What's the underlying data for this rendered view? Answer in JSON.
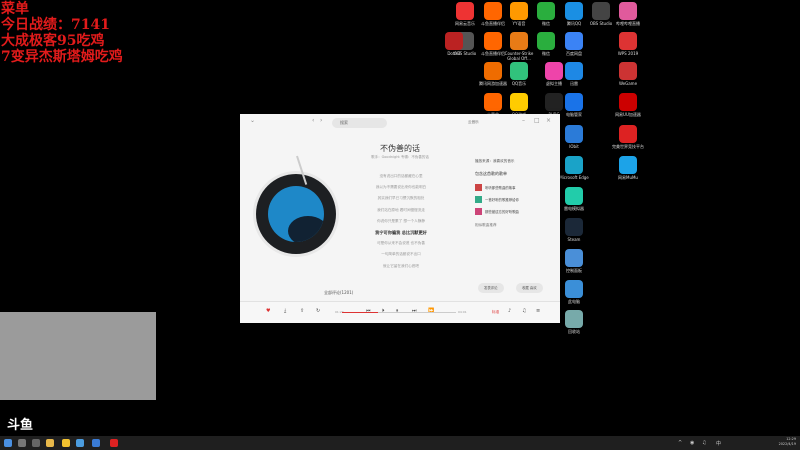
{
  "overlay": {
    "lines": [
      "菜单",
      "今日战绩：7141",
      "大成极客95吃鸡",
      "7变异杰斯塔姆吃鸡"
    ],
    "color": "#e21b1b"
  },
  "desktop_icons": [
    {
      "label": "网易云音乐",
      "color": "#e33"
    },
    {
      "label": "斗鱼直播伴侣",
      "color": "#f60"
    },
    {
      "label": "YY语音",
      "color": "#f90"
    },
    {
      "label": "微信",
      "color": "#2aae3e"
    },
    {
      "label": "腾讯QQ",
      "color": "#1a8fe3"
    },
    {
      "label": "OBS Studio",
      "color": "#444"
    },
    {
      "label": "哔哩哔哩直播",
      "color": "#e05a9c"
    },
    {
      "label": "OBS Studio",
      "color": "#555"
    },
    {
      "label": "Dota 2",
      "color": "#b22"
    },
    {
      "label": "斗鱼直播伴侣",
      "color": "#f60"
    },
    {
      "label": "Counter-Strike Global Off...",
      "color": "#e87b16"
    },
    {
      "label": "微信",
      "color": "#2aae3e"
    },
    {
      "label": "百度网盘",
      "color": "#3b83f5"
    },
    {
      "label": "WPS 2019",
      "color": "#d33"
    },
    {
      "label": "腾讯网游加速器",
      "color": "#ef6c00"
    },
    {
      "label": "QQ音乐",
      "color": "#31c27c"
    },
    {
      "label": "虚拟主播",
      "color": "#e4a"
    },
    {
      "label": "迅雷",
      "color": "#1e88e5"
    },
    {
      "label": "WeGame",
      "color": "#c33"
    },
    {
      "label": "小黑盒",
      "color": "#f60"
    },
    {
      "label": "QQ游戏",
      "color": "#fc0"
    },
    {
      "label": "PUBG",
      "color": "#222"
    },
    {
      "label": "电脑管家",
      "color": "#1a73e8"
    },
    {
      "label": "网易UU加速器",
      "color": "#c00"
    },
    {
      "label": "IObit",
      "color": "#2b7bd8"
    },
    {
      "label": "完美世界竞技平台",
      "color": "#d22"
    },
    {
      "label": "Microsoft Edge",
      "color": "#1aa3c8"
    },
    {
      "label": "网易MuMu",
      "color": "#1ca3e8"
    },
    {
      "label": "雷电模拟器",
      "color": "#2ca"
    },
    {
      "label": "Steam",
      "color": "#1b2838"
    },
    {
      "label": "控制面板",
      "color": "#4a8fd8"
    },
    {
      "label": "此电脑",
      "color": "#3b8fd8"
    },
    {
      "label": "回收站",
      "color": "#7aa"
    }
  ],
  "player": {
    "search_placeholder": "搜索",
    "user_label": "云音乐",
    "song_title": "不伪善的话",
    "song_sub": "歌手：Goodnight  专辑：不伪善的话",
    "lyrics": [
      "没有说出口的话都藏在心里",
      "我以为不需要说出来你也能明白",
      "其实我们早已习惯沉默的相处",
      "我们站在原地 看时间慢慢流走",
      "你说你只是累了 想一个人静静",
      "我宁可你骗我 总比沉默更好",
      "可是你从来不会说谎 也不伪善",
      "一句简单的话都说不出口",
      "就让它留在我们心底吧"
    ],
    "active_lyric_index": 5,
    "comments": "全部评论(1201)",
    "side_heading": "播放来源：我喜欢的音乐",
    "side_title": "包含这首歌的歌单",
    "playlists": [
      {
        "name": "听听那些歌曲的故事",
        "color": "#c44"
      },
      {
        "name": "一首好听的歌推荐给你",
        "color": "#3a8"
      },
      {
        "name": "那些被遗忘的好听歌曲",
        "color": "#c47"
      }
    ],
    "side_more": "相似歌曲推荐",
    "comment_pill": "发表评论",
    "user_pill": "收藏 喜欢",
    "time_current": "01:23",
    "time_total": "04:01",
    "progress_fraction": 0.32,
    "mode_label": "标准"
  },
  "taskbar": {
    "date": "2022/4/19",
    "time": "12:29"
  },
  "logo_text": "斗鱼"
}
